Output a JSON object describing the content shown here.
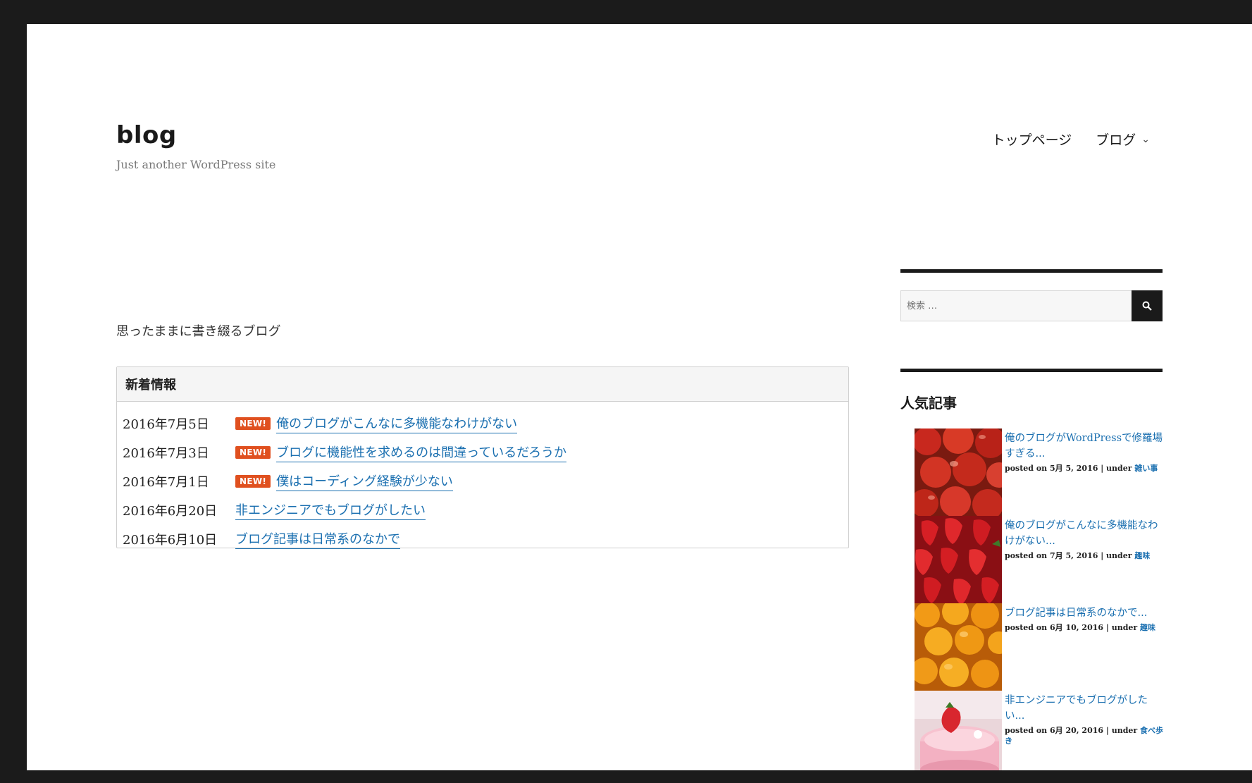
{
  "site": {
    "title": "blog",
    "tagline": "Just another WordPress site"
  },
  "nav": [
    {
      "label": "トップページ",
      "has_dropdown": false
    },
    {
      "label": "ブログ",
      "has_dropdown": true
    }
  ],
  "main": {
    "intro": "思ったままに書き綴るブログ",
    "news": {
      "heading": "新着情報",
      "badge": "NEW!",
      "items": [
        {
          "date": "2016年7月5日",
          "is_new": true,
          "title": "俺のブログがこんなに多機能なわけがない"
        },
        {
          "date": "2016年7月3日",
          "is_new": true,
          "title": "ブログに機能性を求めるのは間違っているだろうか"
        },
        {
          "date": "2016年7月1日",
          "is_new": true,
          "title": "僕はコーディング経験が少ない"
        },
        {
          "date": "2016年6月20日",
          "is_new": false,
          "title": "非エンジニアでもブログがしたい"
        },
        {
          "date": "2016年6月10日",
          "is_new": false,
          "title": "ブログ記事は日常系のなかで"
        }
      ]
    }
  },
  "sidebar": {
    "search_placeholder": "検索 …",
    "popular_heading": "人気記事",
    "popular": [
      {
        "title": "俺のブログがWordPressで修羅場すぎる...",
        "meta_prefix": "posted on 5月 5, 2016 | under ",
        "category": "雑い事",
        "thumb": "apples"
      },
      {
        "title": "俺のブログがこんなに多機能なわけがない...",
        "meta_prefix": "posted on 7月 5, 2016 | under ",
        "category": "趣味",
        "thumb": "strawberries"
      },
      {
        "title": "ブログ記事は日常系のなかで...",
        "meta_prefix": "posted on 6月 10, 2016 | under ",
        "category": "趣味",
        "thumb": "oranges"
      },
      {
        "title": "非エンジニアでもブログがしたい...",
        "meta_prefix": "posted on 6月 20, 2016 | under ",
        "category": "食べ歩き",
        "thumb": "cake"
      }
    ]
  },
  "colors": {
    "link": "#1a6fb0",
    "badge": "#e0501f",
    "rule": "#1a1a1a"
  }
}
